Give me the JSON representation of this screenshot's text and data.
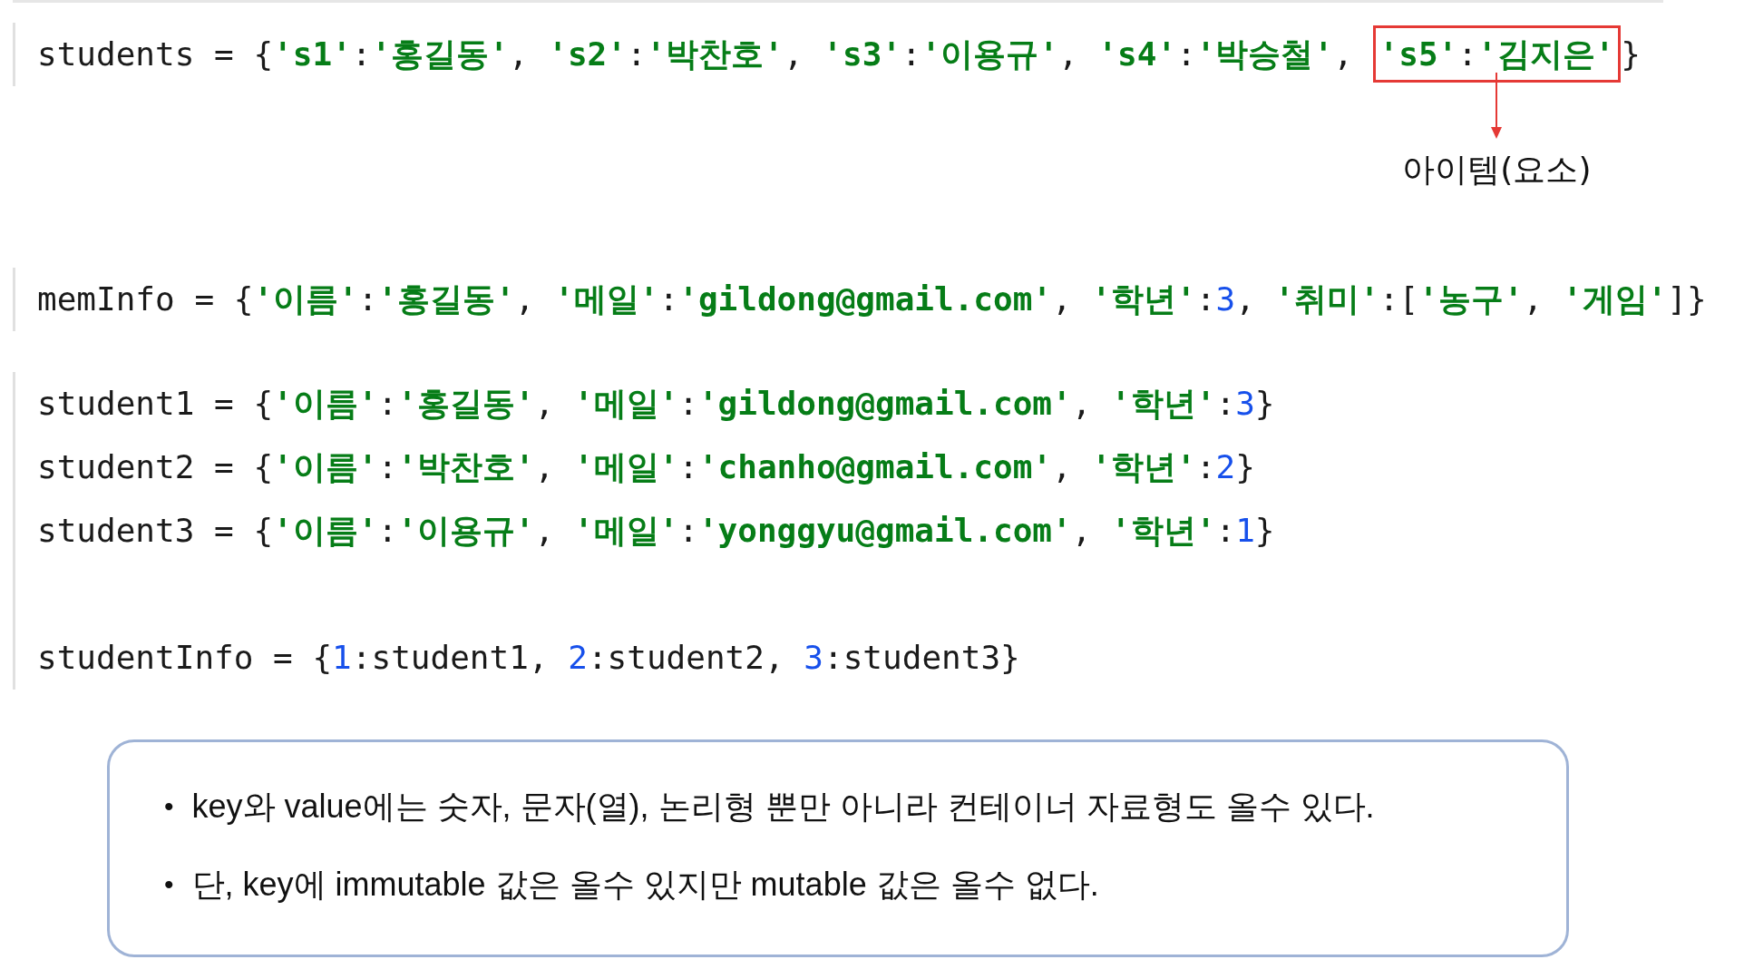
{
  "code_blocks": [
    {
      "groups": [
        [
          {
            "segments": [
              {
                "boxed": false,
                "tokens": [
                  {
                    "kind": "plain",
                    "text": "students = {"
                  },
                  {
                    "kind": "string",
                    "text": "'s1'"
                  },
                  {
                    "kind": "plain",
                    "text": ":"
                  },
                  {
                    "kind": "string",
                    "text": "'홍길동'"
                  },
                  {
                    "kind": "plain",
                    "text": ", "
                  },
                  {
                    "kind": "string",
                    "text": "'s2'"
                  },
                  {
                    "kind": "plain",
                    "text": ":"
                  },
                  {
                    "kind": "string",
                    "text": "'박찬호'"
                  },
                  {
                    "kind": "plain",
                    "text": ", "
                  },
                  {
                    "kind": "string",
                    "text": "'s3'"
                  },
                  {
                    "kind": "plain",
                    "text": ":"
                  },
                  {
                    "kind": "string",
                    "text": "'이용규'"
                  },
                  {
                    "kind": "plain",
                    "text": ", "
                  },
                  {
                    "kind": "string",
                    "text": "'s4'"
                  },
                  {
                    "kind": "plain",
                    "text": ":"
                  },
                  {
                    "kind": "string",
                    "text": "'박승철'"
                  },
                  {
                    "kind": "plain",
                    "text": ", "
                  }
                ]
              },
              {
                "boxed": true,
                "callout": "아이템(요소)",
                "tokens": [
                  {
                    "kind": "string",
                    "text": "'s5'"
                  },
                  {
                    "kind": "plain",
                    "text": ":"
                  },
                  {
                    "kind": "string",
                    "text": "'김지은'"
                  }
                ]
              },
              {
                "boxed": false,
                "tokens": [
                  {
                    "kind": "plain",
                    "text": "}"
                  }
                ]
              }
            ]
          }
        ]
      ]
    },
    {
      "groups": [
        [
          {
            "segments": [
              {
                "boxed": false,
                "tokens": [
                  {
                    "kind": "plain",
                    "text": "memInfo = {"
                  },
                  {
                    "kind": "string",
                    "text": "'이름'"
                  },
                  {
                    "kind": "plain",
                    "text": ":"
                  },
                  {
                    "kind": "string",
                    "text": "'홍길동'"
                  },
                  {
                    "kind": "plain",
                    "text": ", "
                  },
                  {
                    "kind": "string",
                    "text": "'메일'"
                  },
                  {
                    "kind": "plain",
                    "text": ":"
                  },
                  {
                    "kind": "string",
                    "text": "'gildong@gmail.com'"
                  },
                  {
                    "kind": "plain",
                    "text": ", "
                  },
                  {
                    "kind": "string",
                    "text": "'학년'"
                  },
                  {
                    "kind": "plain",
                    "text": ":"
                  },
                  {
                    "kind": "number",
                    "text": "3"
                  },
                  {
                    "kind": "plain",
                    "text": ", "
                  },
                  {
                    "kind": "string",
                    "text": "'취미'"
                  },
                  {
                    "kind": "plain",
                    "text": ":["
                  },
                  {
                    "kind": "string",
                    "text": "'농구'"
                  },
                  {
                    "kind": "plain",
                    "text": ", "
                  },
                  {
                    "kind": "string",
                    "text": "'게임'"
                  },
                  {
                    "kind": "plain",
                    "text": "]}"
                  }
                ]
              }
            ]
          }
        ]
      ]
    },
    {
      "groups": [
        [
          {
            "segments": [
              {
                "boxed": false,
                "tokens": [
                  {
                    "kind": "plain",
                    "text": "student1 = {"
                  },
                  {
                    "kind": "string",
                    "text": "'이름'"
                  },
                  {
                    "kind": "plain",
                    "text": ":"
                  },
                  {
                    "kind": "string",
                    "text": "'홍길동'"
                  },
                  {
                    "kind": "plain",
                    "text": ", "
                  },
                  {
                    "kind": "string",
                    "text": "'메일'"
                  },
                  {
                    "kind": "plain",
                    "text": ":"
                  },
                  {
                    "kind": "string",
                    "text": "'gildong@gmail.com'"
                  },
                  {
                    "kind": "plain",
                    "text": ", "
                  },
                  {
                    "kind": "string",
                    "text": "'학년'"
                  },
                  {
                    "kind": "plain",
                    "text": ":"
                  },
                  {
                    "kind": "number",
                    "text": "3"
                  },
                  {
                    "kind": "plain",
                    "text": "}"
                  }
                ]
              }
            ]
          },
          {
            "segments": [
              {
                "boxed": false,
                "tokens": [
                  {
                    "kind": "plain",
                    "text": "student2 = {"
                  },
                  {
                    "kind": "string",
                    "text": "'이름'"
                  },
                  {
                    "kind": "plain",
                    "text": ":"
                  },
                  {
                    "kind": "string",
                    "text": "'박찬호'"
                  },
                  {
                    "kind": "plain",
                    "text": ", "
                  },
                  {
                    "kind": "string",
                    "text": "'메일'"
                  },
                  {
                    "kind": "plain",
                    "text": ":"
                  },
                  {
                    "kind": "string",
                    "text": "'chanho@gmail.com'"
                  },
                  {
                    "kind": "plain",
                    "text": ", "
                  },
                  {
                    "kind": "string",
                    "text": "'학년'"
                  },
                  {
                    "kind": "plain",
                    "text": ":"
                  },
                  {
                    "kind": "number",
                    "text": "2"
                  },
                  {
                    "kind": "plain",
                    "text": "}"
                  }
                ]
              }
            ]
          },
          {
            "segments": [
              {
                "boxed": false,
                "tokens": [
                  {
                    "kind": "plain",
                    "text": "student3 = {"
                  },
                  {
                    "kind": "string",
                    "text": "'이름'"
                  },
                  {
                    "kind": "plain",
                    "text": ":"
                  },
                  {
                    "kind": "string",
                    "text": "'이용규'"
                  },
                  {
                    "kind": "plain",
                    "text": ", "
                  },
                  {
                    "kind": "string",
                    "text": "'메일'"
                  },
                  {
                    "kind": "plain",
                    "text": ":"
                  },
                  {
                    "kind": "string",
                    "text": "'yonggyu@gmail.com'"
                  },
                  {
                    "kind": "plain",
                    "text": ", "
                  },
                  {
                    "kind": "string",
                    "text": "'학년'"
                  },
                  {
                    "kind": "plain",
                    "text": ":"
                  },
                  {
                    "kind": "number",
                    "text": "1"
                  },
                  {
                    "kind": "plain",
                    "text": "}"
                  }
                ]
              }
            ]
          }
        ],
        [
          {
            "segments": [
              {
                "boxed": false,
                "tokens": [
                  {
                    "kind": "plain",
                    "text": "studentInfo = {"
                  },
                  {
                    "kind": "number",
                    "text": "1"
                  },
                  {
                    "kind": "plain",
                    "text": ":student1, "
                  },
                  {
                    "kind": "number",
                    "text": "2"
                  },
                  {
                    "kind": "plain",
                    "text": ":student2, "
                  },
                  {
                    "kind": "number",
                    "text": "3"
                  },
                  {
                    "kind": "plain",
                    "text": ":student3}"
                  }
                ]
              }
            ]
          }
        ]
      ]
    }
  ],
  "notes": [
    {
      "bullet": "•",
      "text": "key와 value에는 숫자, 문자(열), 논리형 뿐만 아니라 컨테이너 자료형도 올수 있다."
    },
    {
      "bullet": "•",
      "text": "단, key에 immutable 값은 올수 있지만 mutable 값은 올수 없다."
    }
  ]
}
